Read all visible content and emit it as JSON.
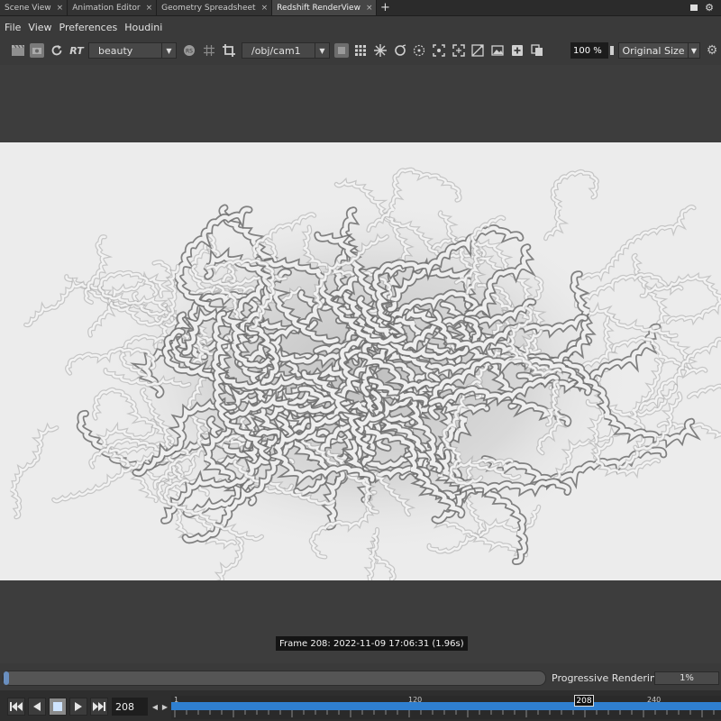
{
  "tabs": [
    {
      "label": "Scene View",
      "close": "×",
      "active": false
    },
    {
      "label": "Animation Editor",
      "close": "×",
      "active": false
    },
    {
      "label": "Geometry Spreadsheet",
      "close": "×",
      "active": false
    },
    {
      "label": "Redshift RenderView",
      "close": "×",
      "active": true
    }
  ],
  "tab_add": "+",
  "menu": [
    "File",
    "View",
    "Preferences",
    "Houdini"
  ],
  "toolbar": {
    "rt_label": "RT",
    "aov_value": "beauty",
    "camera_value": "/obj/cam1",
    "zoom_value": "100 %",
    "size_value": "Original Size"
  },
  "frame_info": "Frame 208:  2022-11-09  17:06:31  (1.96s)",
  "progress": {
    "label": "Progressive Rendering...",
    "percent": "1%",
    "fraction": 0.01
  },
  "timeline": {
    "current_frame": "208",
    "tick_labels": [
      "1",
      "120",
      "240"
    ],
    "marker_label": "208"
  },
  "colors": {
    "timeline_blue": "#2f7fd0",
    "render_bg": "#ececec"
  }
}
